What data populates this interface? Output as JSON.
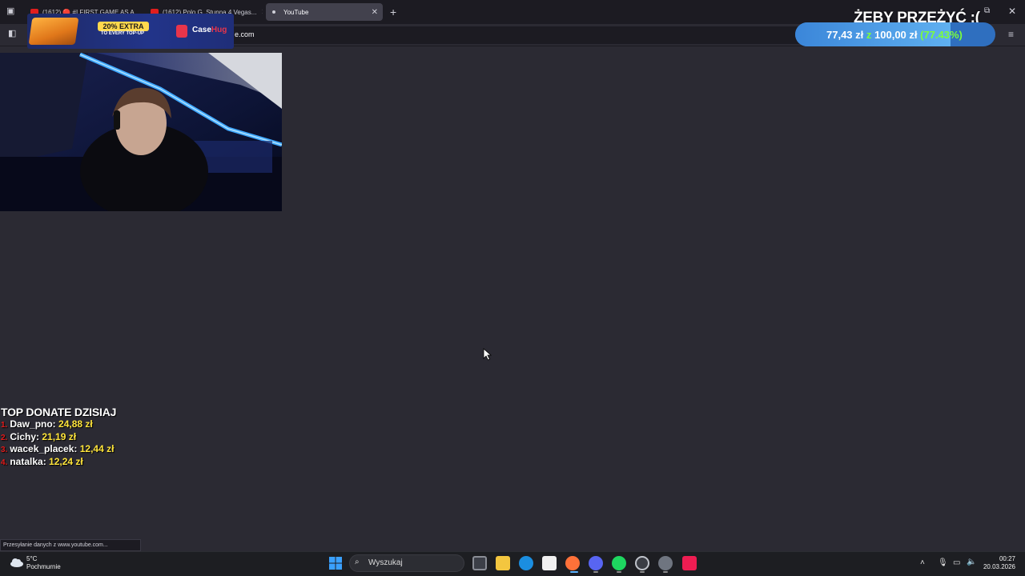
{
  "browser": {
    "tabs": [
      {
        "label": "(1612) 🔴 #I FIRST GAME AS A...",
        "active": false
      },
      {
        "label": "(1612) Polo G, Stunna 4 Vegas...",
        "active": false
      },
      {
        "label": "YouTube",
        "active": true
      }
    ],
    "new_tab_icon": "plus-icon",
    "url_visible_fragment": "e.com"
  },
  "promo": {
    "badge": "20% EXTRA",
    "subtitle": "TO EVERY TOP-UP",
    "brand_main": "Case",
    "brand_accent": "Hug"
  },
  "goal": {
    "title": "ŻEBY PRZEŻYĆ :(",
    "current": "77,43 zł",
    "connector": "z",
    "target": "100,00 zł",
    "percent_text": "(77.43%)",
    "progress": 0.7743
  },
  "donations": {
    "title": "TOP DONATE DZISIAJ",
    "rows": [
      {
        "rank": "1.",
        "name": "Daw_pno:",
        "amount": "24,88 zł"
      },
      {
        "rank": "2.",
        "name": "Cichy:",
        "amount": "21,19 zł"
      },
      {
        "rank": "3.",
        "name": "wacek_placek:",
        "amount": "12,44 zł"
      },
      {
        "rank": "4.",
        "name": "natalka:",
        "amount": "12,24 zł"
      }
    ]
  },
  "status_bar": {
    "text": "Przesyłanie danych z www.youtube.com..."
  },
  "taskbar": {
    "weather_temp": "5°C",
    "weather_condition": "Pochmurnie",
    "search_placeholder": "Wyszukaj",
    "time": "00:27",
    "date": "20.03.2026",
    "apps": [
      "windows-start-icon",
      "task-view-icon",
      "file-explorer-icon",
      "edge-icon",
      "store-icon",
      "firefox-icon",
      "discord-icon",
      "spotify-icon",
      "steam-icon",
      "settings-icon",
      "tiktok-icon"
    ]
  },
  "colors": {
    "page_bg": "#2b2a33",
    "goal_green": "#7cff3a",
    "donate_amount": "#ffe53b",
    "donate_rank": "#e21b1b"
  }
}
